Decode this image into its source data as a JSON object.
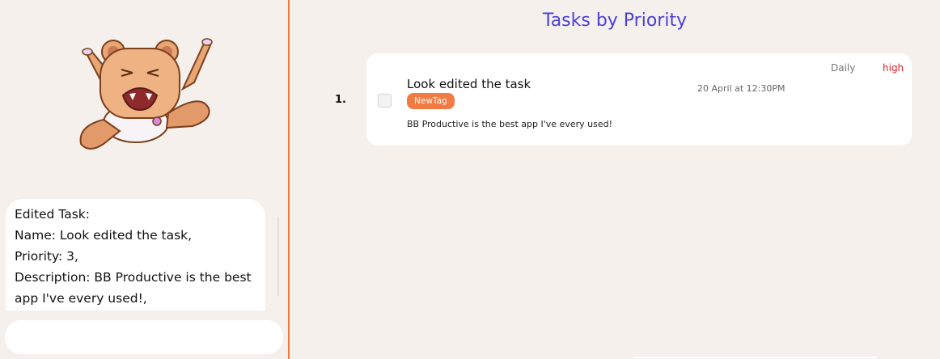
{
  "chat": {
    "bubble_lines": [
      "Edited Task:",
      "Name: Look edited the task,",
      "Priority: 3,",
      "Description: BB Productive is the best",
      "app I've every used!,"
    ],
    "input_value": "",
    "input_placeholder": ""
  },
  "main": {
    "title": "Tasks by Priority",
    "tasks": [
      {
        "index": "1.",
        "name": "Look edited the task",
        "tag": "NewTag",
        "description": "BB Productive is the best app I've every used!",
        "date": "20 April at 12:30PM",
        "repeat": "Daily",
        "priority": "high",
        "completed": false
      }
    ]
  },
  "colors": {
    "accent": "#f07a3a",
    "title": "#4b3fd8",
    "priority_high": "#e0202a",
    "tag_bg": "#f27a43",
    "background": "#f6f0ed"
  },
  "icons": {
    "mascot": "bear-mascot-icon"
  }
}
